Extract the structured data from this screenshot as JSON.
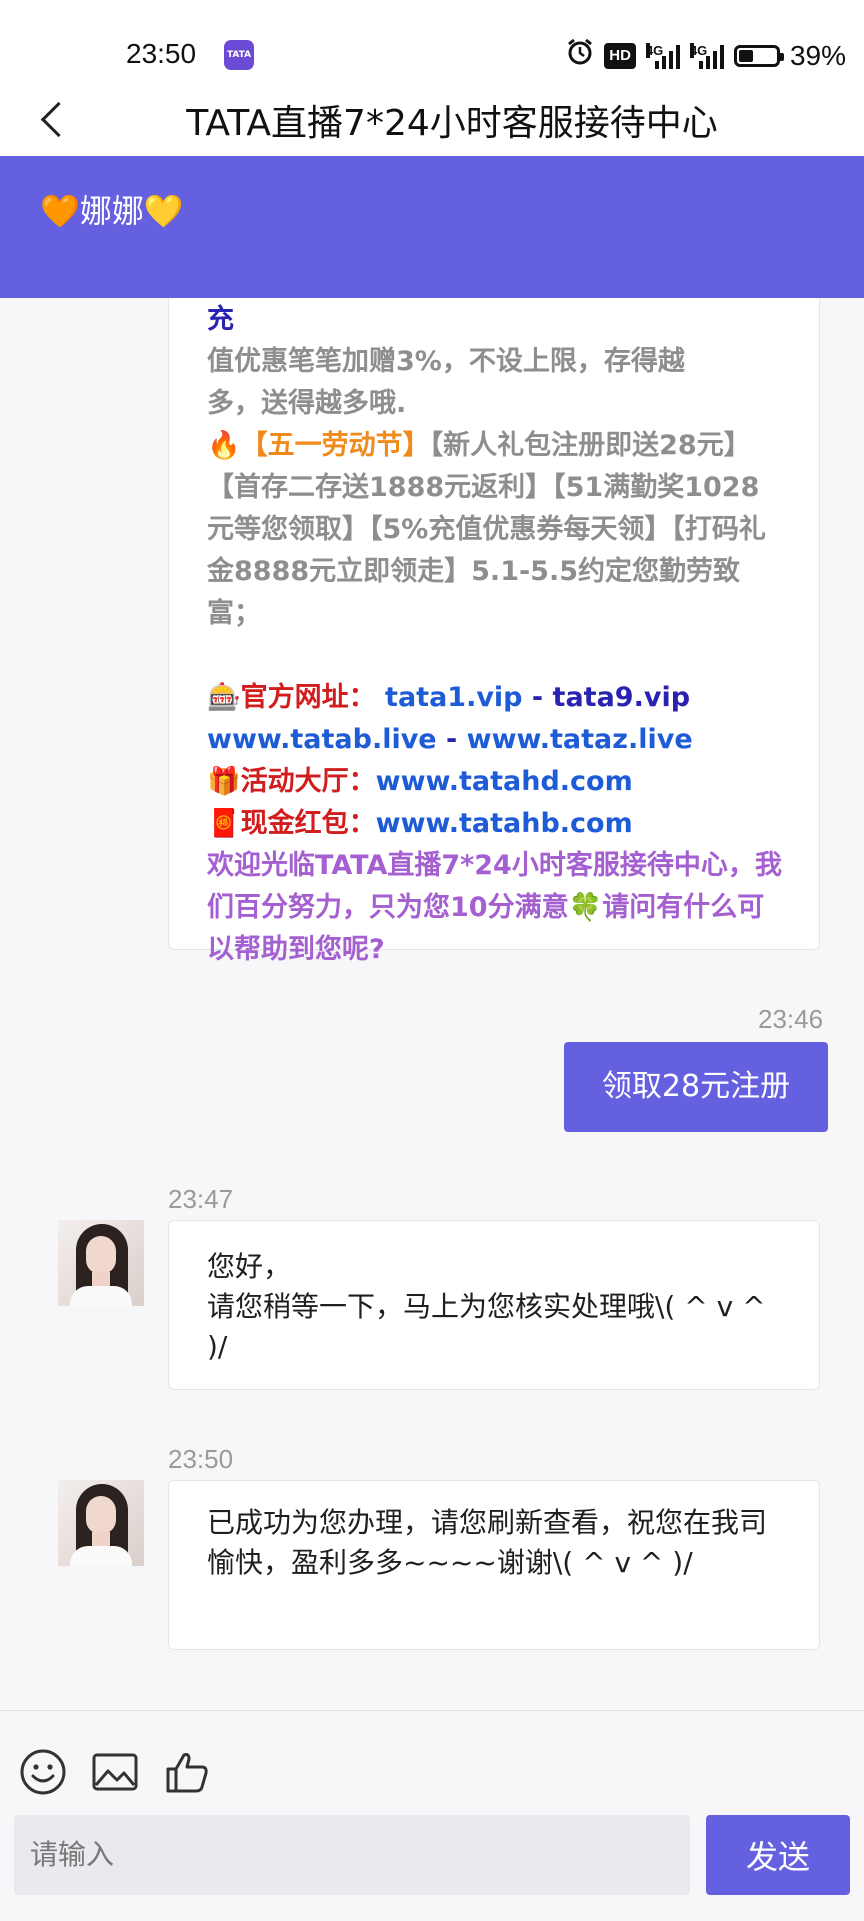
{
  "status_bar": {
    "time": "23:50",
    "app_icon_text": "TATA",
    "hd_label": "HD",
    "sig1_label": "4G",
    "sig2_label": "4G",
    "battery_percent": "39%",
    "battery_level": 0.39
  },
  "header": {
    "title": "TATA直播7*24小时客服接待中心"
  },
  "agent": {
    "name": "🧡娜娜💛"
  },
  "promo": {
    "line_partial": "🔥【Vip+pay+okpay+Gopay】数字钱包充",
    "line_1": "值优惠笔笔加赠3%，不设上限，存得越",
    "line_2": "多，送得越多哦.",
    "labor_tag": "🔥【五一劳动节】",
    "labor_text": "【新人礼包注册即送28元】【首存二存送1888元返利】【51满勤奖1028元等您领取】【5%充值优惠券每天领】【打码礼金8888元立即领走】5.1-5.5约定您勤劳致富；",
    "official_label": "🎰官方网址：",
    "url_1": "tata1.vip",
    "sep": "-",
    "url_2": "tata9.vip",
    "url_3": "www.tatab.live",
    "url_4": "www.tataz.live",
    "activity_label": "🎁活动大厅：",
    "activity_url": "www.tatahd.com",
    "redpacket_label": "🧧现金红包：",
    "redpacket_url": "www.tatahb.com",
    "welcome": "欢迎光临TATA直播7*24小时客服接待中心，我们百分努力，只为您10分满意🍀请问有什么可以帮助到您呢?"
  },
  "messages": {
    "out_time": "23:46",
    "out_text": "领取28元注册",
    "in1_time": "23:47",
    "in1_line1": "您好，",
    "in1_line2": "请您稍等一下，马上为您核实处理哦\\( ^ v ^ )/",
    "in2_time": "23:50",
    "in2_text": "已成功为您办理，请您刷新查看，祝您在我司愉快，盈利多多~~~~谢谢\\( ^ v ^ )/"
  },
  "composer": {
    "placeholder": "请输入",
    "send_label": "发送"
  },
  "icons": [
    "alarm-icon",
    "smile-icon",
    "image-icon",
    "thumbs-up-icon",
    "back-icon"
  ]
}
